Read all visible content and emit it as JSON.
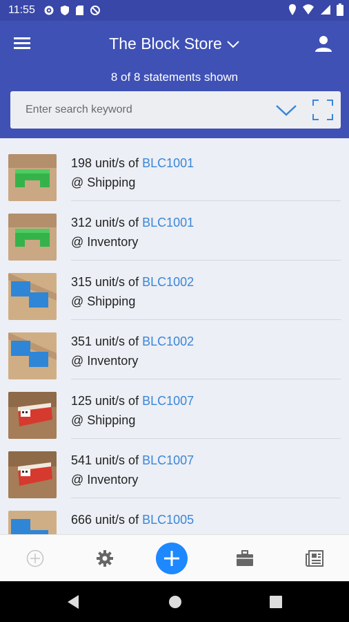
{
  "status_bar": {
    "time": "11:55"
  },
  "header": {
    "store_title": "The Block Store",
    "statements_count": "8 of 8 statements shown"
  },
  "search": {
    "placeholder": "Enter search keyword"
  },
  "statements": [
    {
      "qty": "198 unit/s of ",
      "code": "BLC1001",
      "location": "@ Shipping",
      "thumb": "green"
    },
    {
      "qty": "312 unit/s of ",
      "code": "BLC1001",
      "location": "@ Inventory",
      "thumb": "green"
    },
    {
      "qty": "315 unit/s of ",
      "code": "BLC1002",
      "location": "@ Shipping",
      "thumb": "blue"
    },
    {
      "qty": "351 unit/s of ",
      "code": "BLC1002",
      "location": "@ Inventory",
      "thumb": "blue"
    },
    {
      "qty": "125 unit/s of ",
      "code": "BLC1007",
      "location": "@ Shipping",
      "thumb": "red"
    },
    {
      "qty": "541 unit/s of ",
      "code": "BLC1007",
      "location": "@ Inventory",
      "thumb": "red"
    },
    {
      "qty": "666 unit/s of ",
      "code": "BLC1005",
      "location": "",
      "thumb": "blue"
    }
  ],
  "colors": {
    "appbar": "#3f51b5",
    "statusbar": "#3847a8",
    "link": "#3a86d8",
    "fab": "#1e88ff"
  },
  "icons": [
    "menu-icon",
    "chevron-down-icon",
    "user-icon",
    "scan-icon",
    "add-outline-icon",
    "settings-icon",
    "add-icon",
    "briefcase-icon",
    "news-icon",
    "back-icon",
    "home-icon",
    "recents-icon"
  ]
}
